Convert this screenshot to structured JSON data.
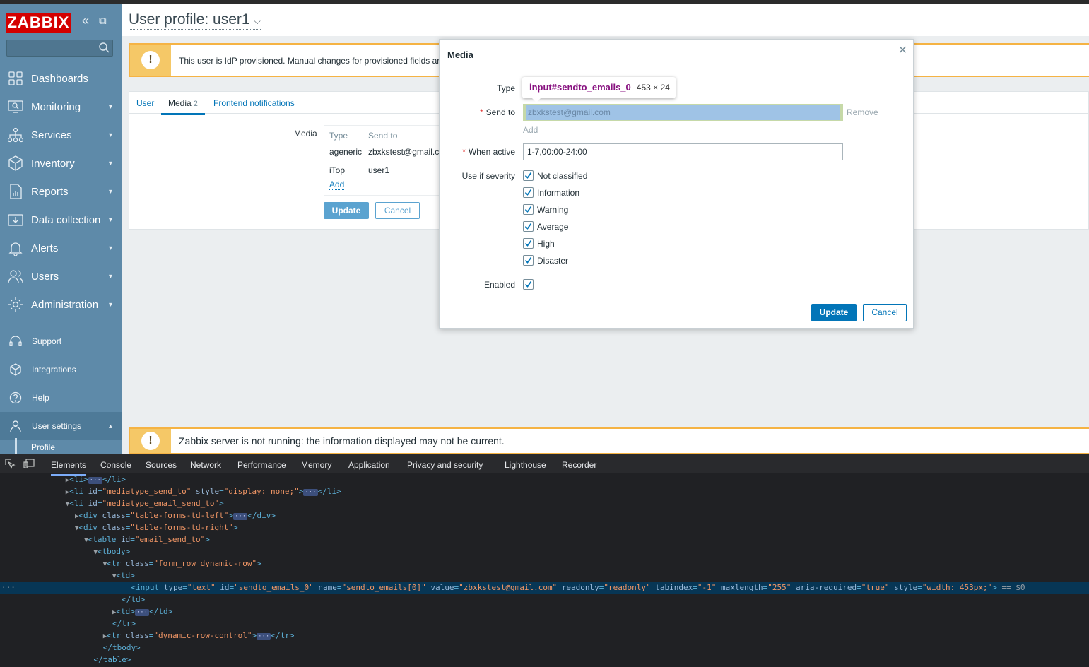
{
  "brand": "ZABBIX",
  "sidebar": {
    "items": [
      {
        "label": "Dashboards",
        "icon": "dashboards-icon",
        "chevron": false
      },
      {
        "label": "Monitoring",
        "icon": "monitoring-icon",
        "chevron": true
      },
      {
        "label": "Services",
        "icon": "services-icon",
        "chevron": true
      },
      {
        "label": "Inventory",
        "icon": "inventory-icon",
        "chevron": true
      },
      {
        "label": "Reports",
        "icon": "reports-icon",
        "chevron": true
      },
      {
        "label": "Data collection",
        "icon": "data-collection-icon",
        "chevron": true
      },
      {
        "label": "Alerts",
        "icon": "alerts-icon",
        "chevron": true
      },
      {
        "label": "Users",
        "icon": "users-icon",
        "chevron": true
      },
      {
        "label": "Administration",
        "icon": "administration-icon",
        "chevron": true
      }
    ],
    "secondary": [
      {
        "label": "Support",
        "icon": "support-icon"
      },
      {
        "label": "Integrations",
        "icon": "integrations-icon"
      },
      {
        "label": "Help",
        "icon": "help-icon"
      },
      {
        "label": "User settings",
        "icon": "user-settings-icon"
      }
    ],
    "subitem": "Profile"
  },
  "page": {
    "title": "User profile: user1",
    "warning_top": "This user is IdP provisioned. Manual changes for provisioned fields ar",
    "warning_bottom": "Zabbix server is not running: the information displayed may not be current.",
    "tabs": [
      {
        "label": "User"
      },
      {
        "label": "Media",
        "count": "2"
      },
      {
        "label": "Frontend notifications"
      }
    ],
    "media_label": "Media",
    "media_table": {
      "headers": [
        "Type",
        "Send to"
      ],
      "rows": [
        {
          "type": "ageneric",
          "send_to": "zbxkstest@gmail.c"
        },
        {
          "type": "iTop",
          "send_to": "user1"
        }
      ],
      "add": "Add"
    },
    "update": "Update",
    "cancel": "Cancel"
  },
  "modal": {
    "title": "Media",
    "type_label": "Type",
    "sendto_label": "Send to",
    "sendto_value": "zbxkstest@gmail.com",
    "remove": "Remove",
    "add": "Add",
    "when_active_label": "When active",
    "when_active_value": "1-7,00:00-24:00",
    "severity_label": "Use if severity",
    "severities": [
      "Not classified",
      "Information",
      "Warning",
      "Average",
      "High",
      "Disaster"
    ],
    "enabled_label": "Enabled",
    "update": "Update",
    "cancel": "Cancel",
    "tooltip_selector": "input#sendto_emails_0",
    "tooltip_size": "453 × 24"
  },
  "devtools": {
    "tabs": [
      "Elements",
      "Console",
      "Sources",
      "Network",
      "Performance",
      "Memory",
      "Application",
      "Privacy and security",
      "Lighthouse",
      "Recorder"
    ],
    "selected_line_suffix": "== $0"
  },
  "colors": {
    "sidebar": "#5e8aa9",
    "accent": "#0275b8",
    "warning": "#f5b344",
    "brand_red": "#d40000"
  }
}
